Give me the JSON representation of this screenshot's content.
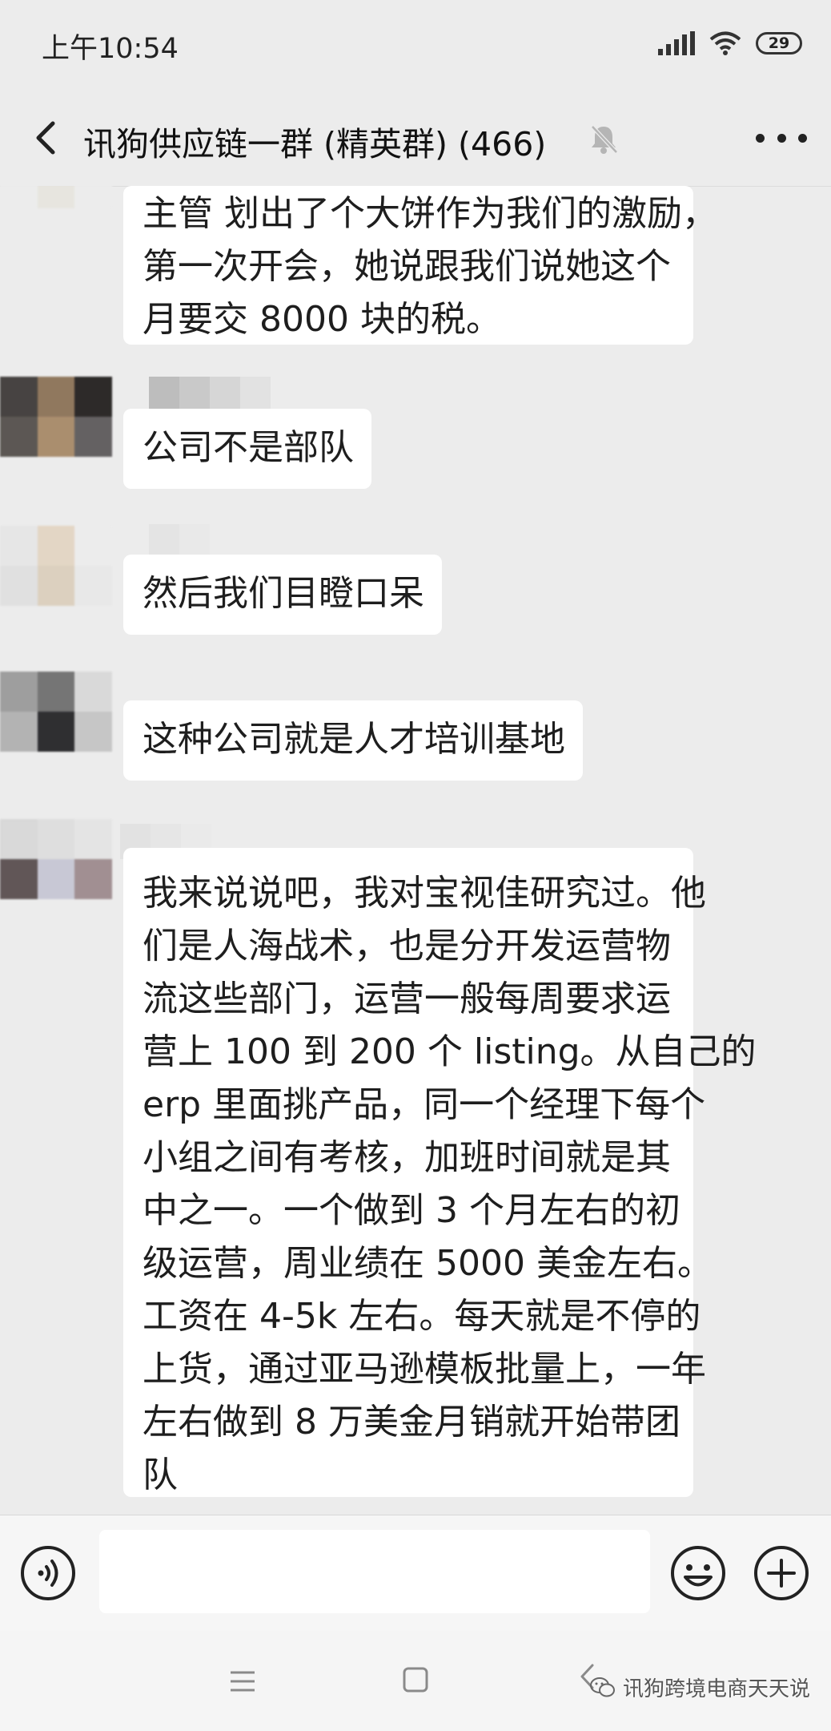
{
  "status_bar": {
    "time": "上午10:54",
    "battery": "29",
    "icons": [
      "signal-icon",
      "wifi-icon",
      "battery-icon"
    ]
  },
  "header": {
    "title": "讯狗供应链一群 (精英群) (466)",
    "icons": [
      "back-arrow-icon",
      "mute-bell-icon",
      "more-dots-icon"
    ]
  },
  "messages": [
    {
      "text": "主管 划出了个大饼作为我们的激励，\n第一次开会，她说跟我们说她这个\n月要交 8000 块的税。"
    },
    {
      "text": "公司不是部队"
    },
    {
      "text": "然后我们目瞪口呆"
    },
    {
      "text": "这种公司就是人才培训基地"
    },
    {
      "text": "我来说说吧，我对宝视佳研究过。他\n们是人海战术，也是分开发运营物\n流这些部门，运营一般每周要求运\n营上 100 到 200 个 listing。从自己的\nerp 里面挑产品，同一个经理下每个\n小组之间有考核，加班时间就是其\n中之一。一个做到 3 个月左右的初\n级运营，周业绩在 5000 美金左右。\n工资在 4-5k 左右。每天就是不停的\n上货，通过亚马逊模板批量上，一年\n左右做到 8 万美金月销就开始带团\n队"
    }
  ],
  "input_bar": {
    "icons": [
      "voice-icon",
      "emoji-icon",
      "plus-icon"
    ]
  },
  "nav_bar": {
    "icons": [
      "menu-icon",
      "home-icon",
      "back-icon"
    ],
    "watermark": "讯狗跨境电商天天说"
  },
  "colors": {
    "background": "#ececec",
    "bubble": "#ffffff",
    "text": "#1e1e1e"
  }
}
